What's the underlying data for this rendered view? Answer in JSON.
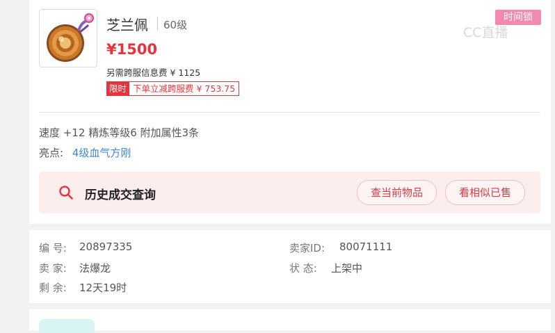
{
  "item": {
    "name": "芝兰佩",
    "level": "60级",
    "price": "¥1500",
    "extra_fee": "另需跨服信息费 ¥ 1125",
    "promo_tag": "限时",
    "promo_text": "下单立减跨服费 ¥ 753.75",
    "badge": "时间锁",
    "watermark": "CC直播",
    "icon": "jade-pendant-icon"
  },
  "attributes": {
    "text": "速度 +12 精炼等级6 附加属性3条",
    "highlight_label": "亮点:",
    "highlight_value": "4级血气方刚"
  },
  "history": {
    "title": "历史成交查询",
    "icon": "search-icon",
    "buttons": [
      "查当前物品",
      "看相似已售"
    ]
  },
  "info": {
    "id_label": "编 号:",
    "id_value": "20897335",
    "seller_id_label": "卖家ID:",
    "seller_id_value": "80071111",
    "seller_label": "卖 家:",
    "seller_value": "法爆龙",
    "status_label": "状 态:",
    "status_value": "上架中",
    "remaining_label": "剩 余:",
    "remaining_value": "12天19时"
  },
  "colors": {
    "price_red": "#e8333b",
    "link_blue": "#3d87d6",
    "badge_pink": "#f28ab0",
    "history_bg": "#fdeeee"
  }
}
